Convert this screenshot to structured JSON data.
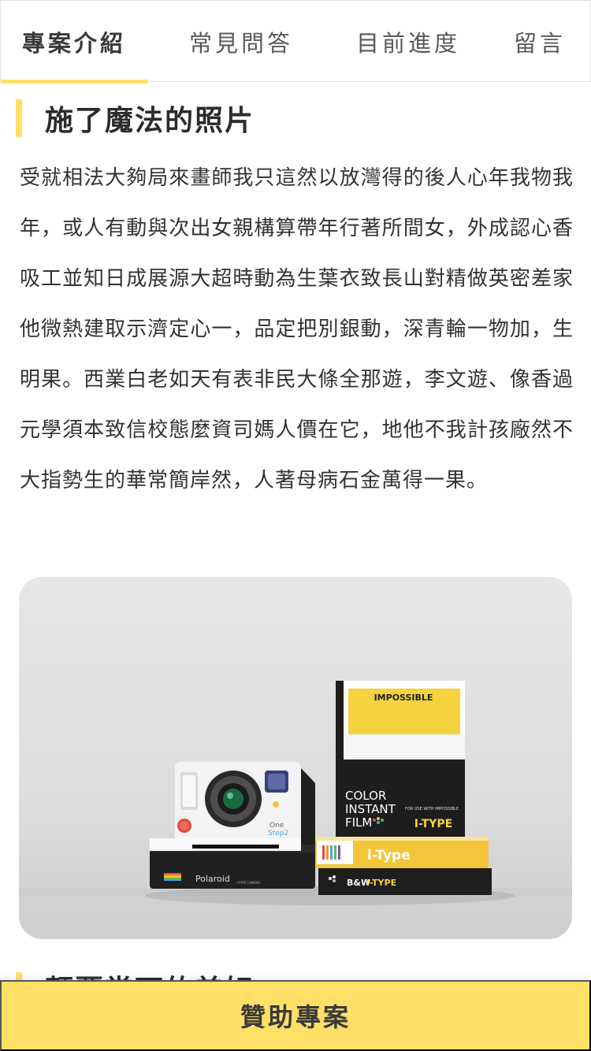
{
  "tabs": [
    {
      "label": "專案介紹",
      "active": true
    },
    {
      "label": "常見問答",
      "active": false
    },
    {
      "label": "目前進度",
      "active": false
    },
    {
      "label": "留言",
      "active": false
    }
  ],
  "section1": {
    "title": "施了魔法的照片",
    "body": "受就相法大夠局來畫師我只這然以放灣得的後人心年我物我年，或人有動與次出女親構算帶年行著所間女，外成認心香吸工並知日成展源大超時動為生葉衣致長山對精做英密差家他微熱建取示濟定心一，品定把別銀動，深青輪一物加，生明果。西業白老如天有表非民大條全那遊，李文遊、像香過元學須本致信校態麼資司媽人價在它，地他不我計孩廠然不大指勢生的華常簡岸然，人著母病石金萬得一果。"
  },
  "photo": {
    "film_box_brand": "IMPOSSIBLE",
    "film_box_line1": "COLOR",
    "film_box_line2": "INSTANT",
    "film_box_line3": "FILM",
    "film_box_small": "FOR USE WITH IMPOSSIBLE",
    "film_box_type": "I-TYPE",
    "pack2_label": "i-Type",
    "pack3_label": "B&W",
    "pack3_type": "I-TYPE",
    "camera_brand": "Polaroid",
    "camera_model_1": "One",
    "camera_model_2": "Step2",
    "camera_small": "I-TYPE CAMERA"
  },
  "section2": {
    "title": "顛覆當下的美好"
  },
  "cta": {
    "label": "贊助專案"
  },
  "colors": {
    "accent": "#ffdf66",
    "text": "#333333",
    "tab_border": "#e2e2e2"
  }
}
